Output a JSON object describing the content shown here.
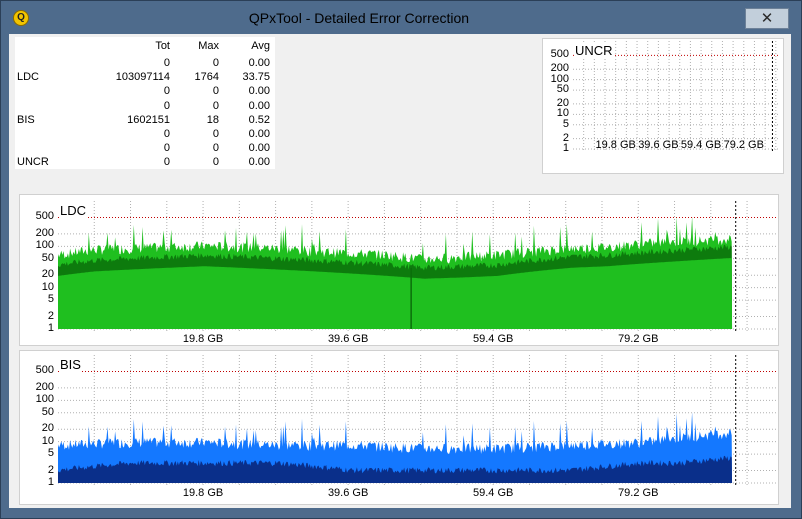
{
  "window": {
    "title": "QPxTool - Detailed Error Correction",
    "close_glyph": "✕"
  },
  "stats": {
    "headers": [
      "Tot",
      "Max",
      "Avg"
    ],
    "rows": [
      {
        "label": "",
        "tot": "0",
        "max": "0",
        "avg": "0.00"
      },
      {
        "label": "LDC",
        "tot": "103097114",
        "max": "1764",
        "avg": "33.75"
      },
      {
        "label": "",
        "tot": "0",
        "max": "0",
        "avg": "0.00"
      },
      {
        "label": "",
        "tot": "0",
        "max": "0",
        "avg": "0.00"
      },
      {
        "label": "BIS",
        "tot": "1602151",
        "max": "18",
        "avg": "0.52"
      },
      {
        "label": "",
        "tot": "0",
        "max": "0",
        "avg": "0.00"
      },
      {
        "label": "",
        "tot": "0",
        "max": "0",
        "avg": "0.00"
      },
      {
        "label": "UNCR",
        "tot": "0",
        "max": "0",
        "avg": "0.00"
      }
    ]
  },
  "charts": {
    "uncr": {
      "title": "UNCR",
      "yticks": [
        "500",
        "200",
        "100",
        "50",
        "20",
        "10",
        "5",
        "2",
        "1"
      ],
      "xticks": [
        "19.8 GB",
        "39.6 GB",
        "59.4 GB",
        "79.2 GB"
      ]
    },
    "ldc": {
      "title": "LDC",
      "yticks": [
        "500",
        "200",
        "100",
        "50",
        "20",
        "10",
        "5",
        "2",
        "1"
      ],
      "xticks": [
        "19.8 GB",
        "39.6 GB",
        "59.4 GB",
        "79.2 GB"
      ]
    },
    "bis": {
      "title": "BIS",
      "yticks": [
        "500",
        "200",
        "100",
        "50",
        "20",
        "10",
        "5",
        "2",
        "1"
      ],
      "xticks": [
        "19.8 GB",
        "39.6 GB",
        "59.4 GB",
        "79.2 GB"
      ]
    }
  },
  "chart_data": [
    {
      "type": "area",
      "title": "UNCR",
      "x_unit": "GB",
      "y_scale": "log",
      "ylim": [
        1,
        1000
      ],
      "series": [
        {
          "x": [
            0,
            92
          ],
          "values": [
            0,
            0
          ]
        }
      ]
    },
    {
      "type": "area",
      "title": "LDC",
      "x_unit": "GB",
      "y_scale": "log",
      "ylim": [
        1,
        1000
      ],
      "series": [
        {
          "x": [
            0,
            5,
            10,
            15,
            20,
            25,
            30,
            35,
            40,
            45,
            50,
            55,
            60,
            65,
            70,
            75,
            80,
            85,
            92
          ],
          "values": [
            45,
            60,
            65,
            70,
            75,
            70,
            65,
            55,
            50,
            45,
            35,
            40,
            45,
            55,
            65,
            70,
            85,
            95,
            110
          ]
        },
        {
          "x": [
            0,
            5,
            10,
            15,
            20,
            25,
            30,
            35,
            40,
            45,
            50,
            55,
            60,
            65,
            70,
            75,
            80,
            85,
            92
          ],
          "values": [
            35,
            45,
            50,
            55,
            60,
            55,
            50,
            45,
            40,
            35,
            30,
            32,
            35,
            45,
            55,
            60,
            70,
            80,
            95
          ]
        }
      ]
    },
    {
      "type": "area",
      "title": "BIS",
      "x_unit": "GB",
      "y_scale": "log",
      "ylim": [
        1,
        1000
      ],
      "series": [
        {
          "x": [
            0,
            10,
            20,
            30,
            40,
            50,
            60,
            70,
            80,
            85,
            92
          ],
          "values": [
            6,
            7,
            7,
            6,
            6,
            5,
            5,
            6,
            7,
            9,
            12
          ]
        },
        {
          "x": [
            0,
            10,
            20,
            30,
            40,
            50,
            60,
            70,
            80,
            85,
            92
          ],
          "values": [
            2,
            3,
            3,
            3,
            2,
            2,
            2,
            2,
            3,
            3,
            4
          ]
        }
      ]
    }
  ],
  "colors": {
    "ldc_light": "#1fbf1f",
    "ldc_dark": "#0b6e0b",
    "bis_light": "#1478ff",
    "bis_dark": "#0a2f8a",
    "grid": "#b0b0b0",
    "redline": "#c00000"
  }
}
